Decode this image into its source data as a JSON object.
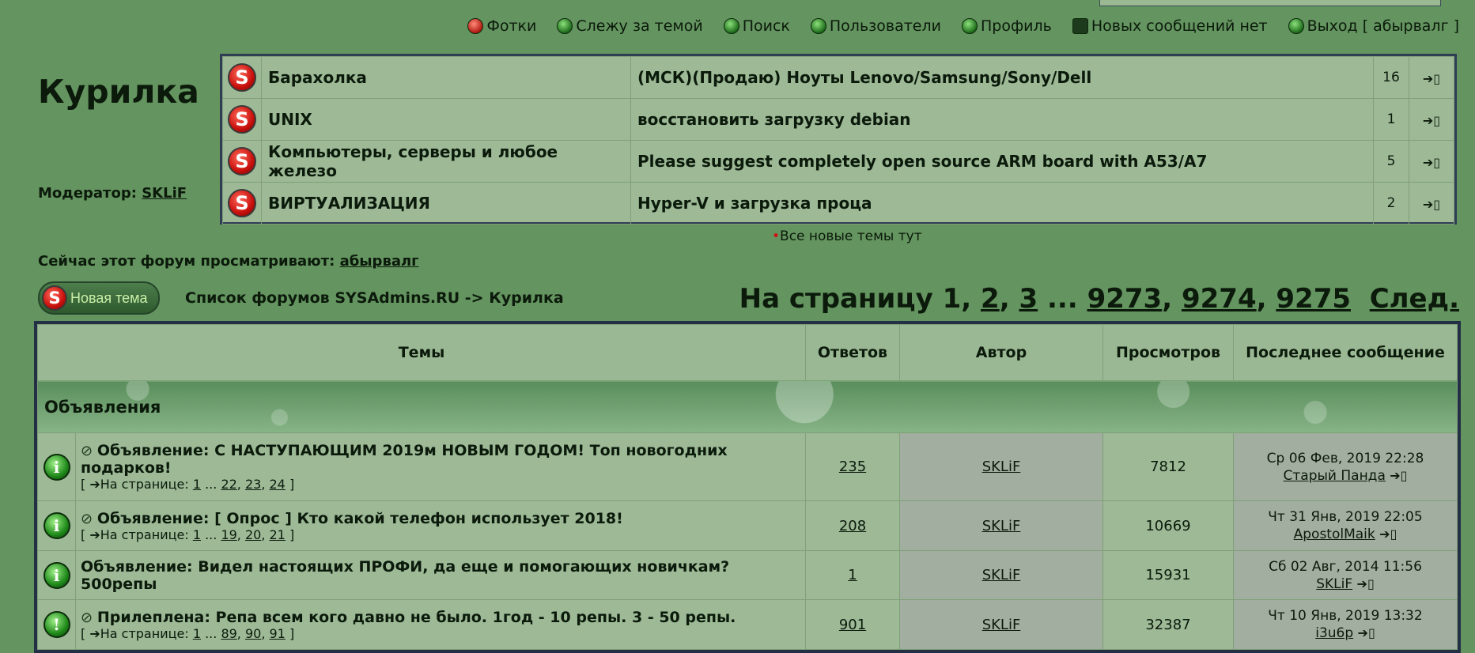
{
  "nav": [
    {
      "label": "Фотки",
      "icon": "photo-icon"
    },
    {
      "label": "Слежу за темой",
      "icon": "watch-icon"
    },
    {
      "label": "Поиск",
      "icon": "search-icon"
    },
    {
      "label": "Пользователи",
      "icon": "users-icon"
    },
    {
      "label": "Профиль",
      "icon": "profile-icon"
    },
    {
      "label": "Новых сообщений нет",
      "icon": "mail-icon"
    },
    {
      "label": "Выход [ абырвалг ]",
      "icon": "logout-icon"
    }
  ],
  "forum": {
    "title": "Курилка",
    "moderator_label": "Модератор:",
    "moderator": "SKLiF",
    "viewing_label": "Сейчас этот форум просматривают:",
    "viewing_user": "абырвалг"
  },
  "new_topics": [
    {
      "forum": "Барахолка",
      "topic": "(МСК)(Продаю) Ноуты Lenovo/Samsung/Sony/Dell",
      "count": "16"
    },
    {
      "forum": "UNIX",
      "topic": "восстановить загрузку debian",
      "count": "1"
    },
    {
      "forum": "Компьютеры, серверы и любое железо",
      "topic": "Please suggest completely open source ARM board with A53/A7",
      "count": "5"
    },
    {
      "forum": "ВИРТУАЛИЗАЦИЯ",
      "topic": "Hyper-V и загрузка проца",
      "count": "2"
    }
  ],
  "all_new_link": "Все новые темы тут",
  "new_topic_button": "Новая тема",
  "breadcrumb": "Список форумов SYSAdmins.RU -> Курилка",
  "pagination": {
    "prefix": "На страницу",
    "current": "1",
    "pages": [
      "2",
      "3",
      "9273",
      "9274",
      "9275"
    ],
    "ellipsis": "...",
    "next": "След."
  },
  "table": {
    "headers": {
      "topics": "Темы",
      "replies": "Ответов",
      "author": "Автор",
      "views": "Просмотров",
      "last": "Последнее сообщение"
    },
    "category": "Объявления",
    "rows": [
      {
        "title": "Объявление: С НАСТУПАЮЩИМ 2019м НОВЫМ ГОДОМ! Топ новогодних подарков!",
        "pages_prefix": "На странице:",
        "pages": [
          "1",
          "22",
          "23",
          "24"
        ],
        "replies": "235",
        "author": "SKLiF",
        "views": "7812",
        "last_date": "Ср 06 Фев, 2019 22:28",
        "last_user": "Старый Панда"
      },
      {
        "title": "Объявление: [ Опрос ] Кто какой телефон использует 2018!",
        "pages_prefix": "На странице:",
        "pages": [
          "1",
          "19",
          "20",
          "21"
        ],
        "replies": "208",
        "author": "SKLiF",
        "views": "10669",
        "last_date": "Чт 31 Янв, 2019 22:05",
        "last_user": "ApostolMaik"
      },
      {
        "title": "Объявление: Видел настоящих ПРОФИ, да еще и помогающих новичкам? 500репы",
        "replies": "1",
        "author": "SKLiF",
        "views": "15931",
        "last_date": "Сб 02 Авг, 2014 11:56",
        "last_user": "SKLiF"
      },
      {
        "title": "Прилеплена: Репа всем кого давно не было. 1год - 10 репы. 3 - 50 репы.",
        "pages_prefix": "На странице:",
        "pages": [
          "1",
          "89",
          "90",
          "91"
        ],
        "replies": "901",
        "author": "SKLiF",
        "views": "32387",
        "last_date": "Чт 10 Янв, 2019 13:32",
        "last_user": "i3u6p"
      }
    ]
  }
}
